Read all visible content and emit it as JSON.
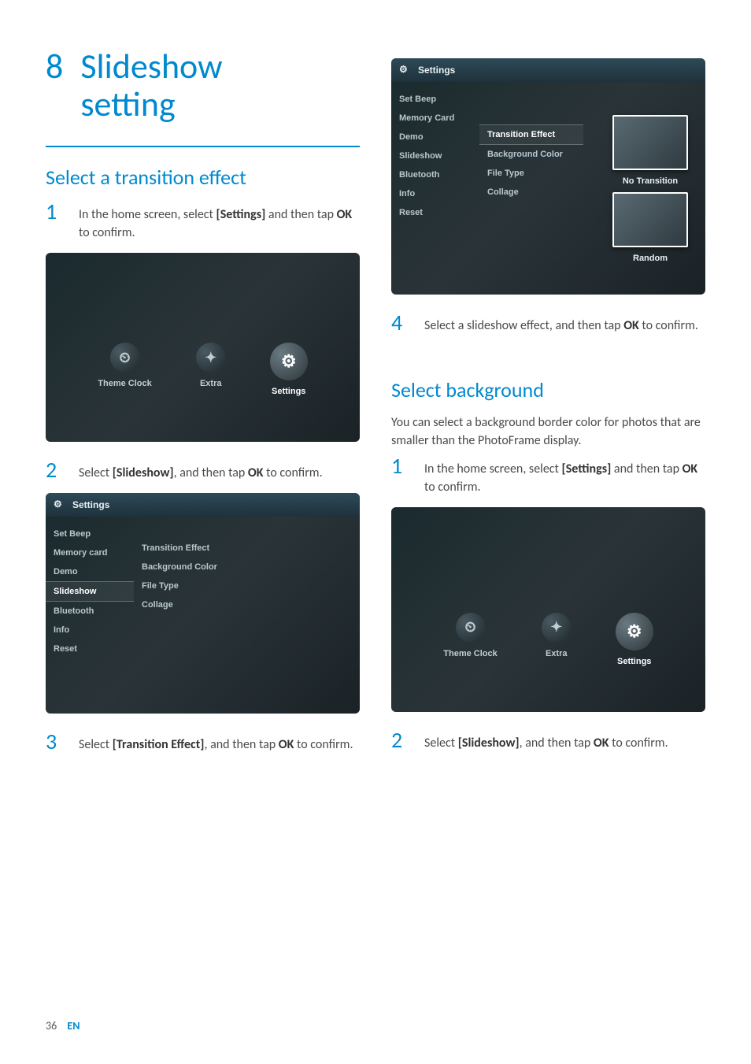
{
  "page": {
    "number": "36",
    "lang": "EN"
  },
  "chapter": {
    "number": "8",
    "title_line1": "Slideshow",
    "title_line2": "setting"
  },
  "sectionA": {
    "heading": "Select a transition effect"
  },
  "sectionB": {
    "heading": "Select background"
  },
  "introB": "You can select a background border color for photos that are smaller than the PhotoFrame display.",
  "steps": {
    "a1": {
      "num": "1",
      "pre": "In the home screen, select ",
      "bold1": "[Settings]",
      "mid": " and then tap ",
      "bold2": "OK",
      "post": " to confirm."
    },
    "a2": {
      "num": "2",
      "pre": "Select ",
      "bold1": "[Slideshow]",
      "mid": ", and then tap ",
      "bold2": "OK",
      "post": " to confirm."
    },
    "a3": {
      "num": "3",
      "pre": "Select ",
      "bold1": "[Transition Effect]",
      "mid": ", and then tap ",
      "bold2": "OK",
      "post": " to confirm."
    },
    "a4": {
      "num": "4",
      "pre": "Select a slideshow effect, and then tap ",
      "bold1": "OK",
      "mid": "",
      "bold2": "",
      "post": " to confirm."
    },
    "b1": {
      "num": "1",
      "pre": "In the home screen, select ",
      "bold1": "[Settings]",
      "mid": " and then tap ",
      "bold2": "OK",
      "post": " to confirm."
    },
    "b2": {
      "num": "2",
      "pre": "Select ",
      "bold1": "[Slideshow]",
      "mid": ", and then tap ",
      "bold2": "OK",
      "post": " to confirm."
    }
  },
  "ui": {
    "settings_title": "Settings",
    "home_icons": {
      "theme": "Theme Clock",
      "extra": "Extra",
      "settings": "Settings"
    },
    "sidebar": {
      "set_beep": "Set Beep",
      "memory_card": "Memory Card",
      "memory_card2": "Memory card",
      "demo": "Demo",
      "slideshow": "Slideshow",
      "bluetooth": "Bluetooth",
      "info": "Info",
      "reset": "Reset"
    },
    "sublist": {
      "transition": "Transition Effect",
      "bgcolor": "Background Color",
      "filetype": "File Type",
      "collage": "Collage"
    },
    "preview": {
      "no_transition": "No Transition",
      "random": "Random"
    }
  }
}
